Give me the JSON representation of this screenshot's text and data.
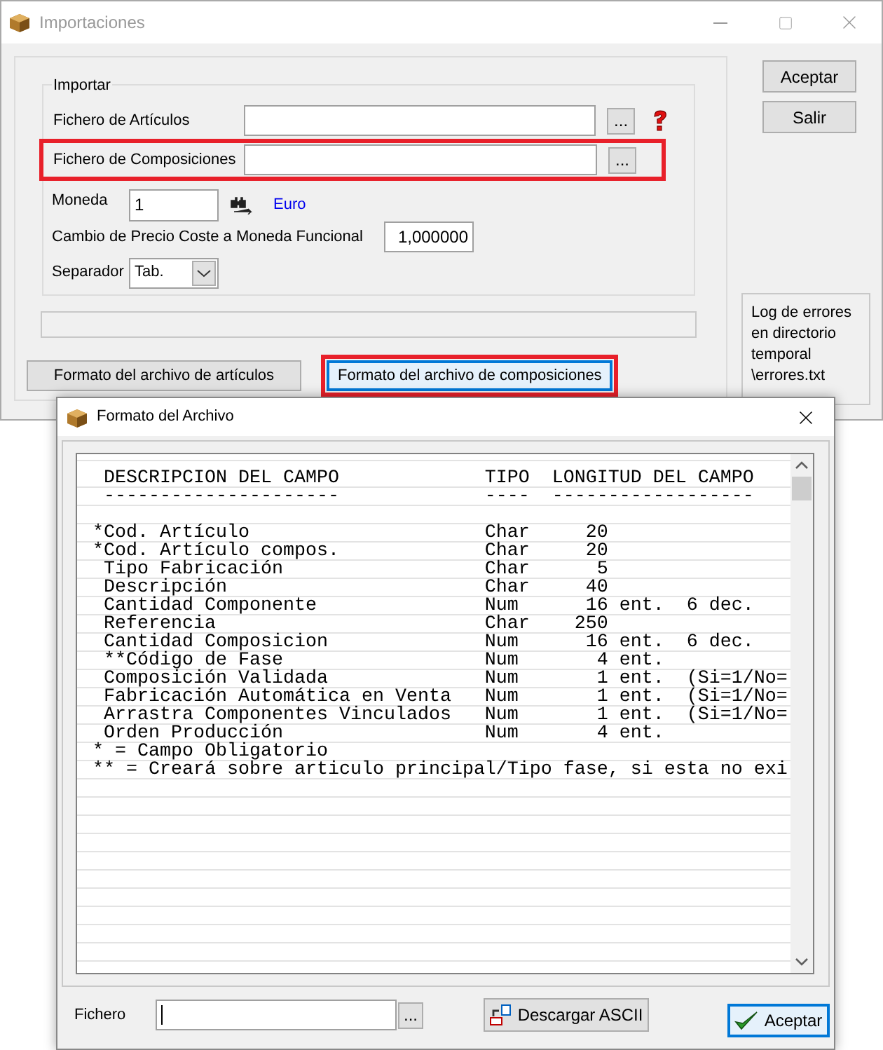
{
  "main_window": {
    "title": "Importaciones",
    "group": {
      "title": "Importar",
      "files": [
        {
          "label": "Fichero de Artículos",
          "browse": "...",
          "help": true,
          "highlighted": false
        },
        {
          "label": "Fichero de Composiciones",
          "browse": "...",
          "help": false,
          "highlighted": true
        }
      ],
      "currency": {
        "label": "Moneda",
        "value": "1",
        "name": "Euro"
      },
      "exchange": {
        "label": "Cambio de Precio Coste a Moneda Funcional",
        "value": "1,000000"
      },
      "separator": {
        "label": "Separador",
        "value": "Tab."
      }
    },
    "format_buttons": [
      {
        "label": "Formato del archivo de artículos",
        "focused": false,
        "highlighted": false
      },
      {
        "label": "Formato del archivo de composiciones",
        "focused": true,
        "highlighted": true
      }
    ],
    "buttons": [
      {
        "label": "Aceptar"
      },
      {
        "label": "Salir"
      }
    ],
    "log_note": "Log de errores en directorio temporal \\errores.txt"
  },
  "dialog": {
    "title": "Formato del Archivo",
    "lines": [
      {
        "kind": "text",
        "text": " DESCRIPCION DEL CAMPO             TIPO  LONGITUD DEL CAMPO"
      },
      {
        "kind": "text",
        "text": " ---------------------             ----  ------------------"
      },
      {
        "kind": "blank"
      },
      {
        "kind": "text",
        "text": "*Cod. Artículo                     Char     20"
      },
      {
        "kind": "text",
        "text": "*Cod. Artículo compos.             Char     20"
      },
      {
        "kind": "text",
        "text": " Tipo Fabricación                  Char      5"
      },
      {
        "kind": "text",
        "text": " Descripción                       Char     40"
      },
      {
        "kind": "text",
        "text": " Cantidad Componente               Num      16 ent.  6 dec."
      },
      {
        "kind": "text",
        "text": " Referencia                        Char    250"
      },
      {
        "kind": "text",
        "text": " Cantidad Composicion              Num      16 ent.  6 dec."
      },
      {
        "kind": "text",
        "text": " **Código de Fase                  Num       4 ent."
      },
      {
        "kind": "text",
        "text": " Composición Validada              Num       1 ent.  (Si=1/No="
      },
      {
        "kind": "text",
        "text": " Fabricación Automática en Venta   Num       1 ent.  (Si=1/No="
      },
      {
        "kind": "text",
        "text": " Arrastra Componentes Vinculados   Num       1 ent.  (Si=1/No="
      },
      {
        "kind": "text",
        "text": " Orden Producción                  Num       4 ent."
      },
      {
        "kind": "text",
        "text": "* = Campo Obligatorio"
      },
      {
        "kind": "text",
        "text": "** = Creará sobre articulo principal/Tipo fase, si esta no exi"
      }
    ],
    "file_label": "Fichero",
    "browse": "...",
    "download_button": "Descargar ASCII",
    "ok_button": "Aceptar"
  }
}
